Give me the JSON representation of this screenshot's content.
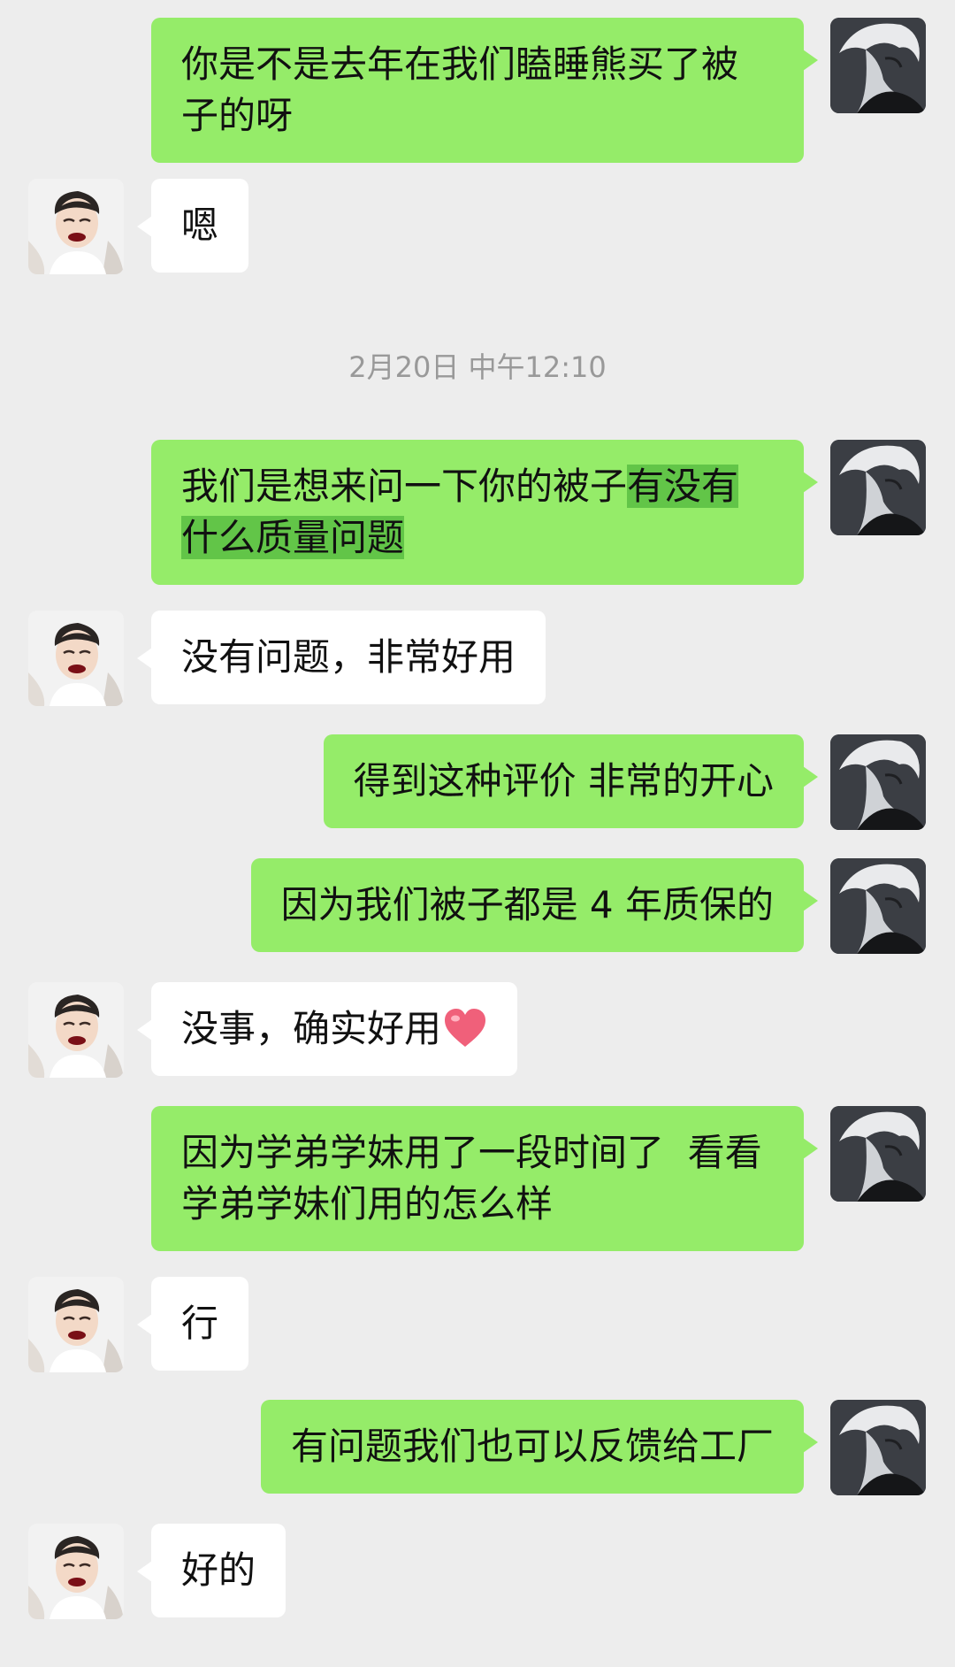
{
  "chat": {
    "timestamp": "2月20日 中午12:10",
    "messages": [
      {
        "id": "m1",
        "from": "me",
        "text": "你是不是去年在我们瞌睡熊买了被子的呀"
      },
      {
        "id": "m2",
        "from": "customer",
        "text": "嗯"
      },
      {
        "id": "m3",
        "from": "me",
        "text_plain": "我们是想来问一下你的被子",
        "text_highlight": "有没有什么质量问题"
      },
      {
        "id": "m4",
        "from": "customer",
        "text": "没有问题，非常好用"
      },
      {
        "id": "m5",
        "from": "me",
        "text": "得到这种评价 非常的开心"
      },
      {
        "id": "m6",
        "from": "me",
        "text": "因为我们被子都是 4 年质保的"
      },
      {
        "id": "m7",
        "from": "customer",
        "text": "没事，确实好用",
        "emoji": "heart-icon"
      },
      {
        "id": "m8",
        "from": "me",
        "text": "因为学弟学妹用了一段时间了  看看学弟学妹们用的怎么样"
      },
      {
        "id": "m9",
        "from": "customer",
        "text": "行"
      },
      {
        "id": "m10",
        "from": "me",
        "text": "有问题我们也可以反馈给工厂"
      },
      {
        "id": "m11",
        "from": "customer",
        "text": "好的"
      }
    ]
  },
  "colors": {
    "background": "#ededed",
    "outgoing_bubble": "#95ec69",
    "incoming_bubble": "#ffffff",
    "highlight": "#62c548",
    "timestamp_text": "#999999"
  }
}
